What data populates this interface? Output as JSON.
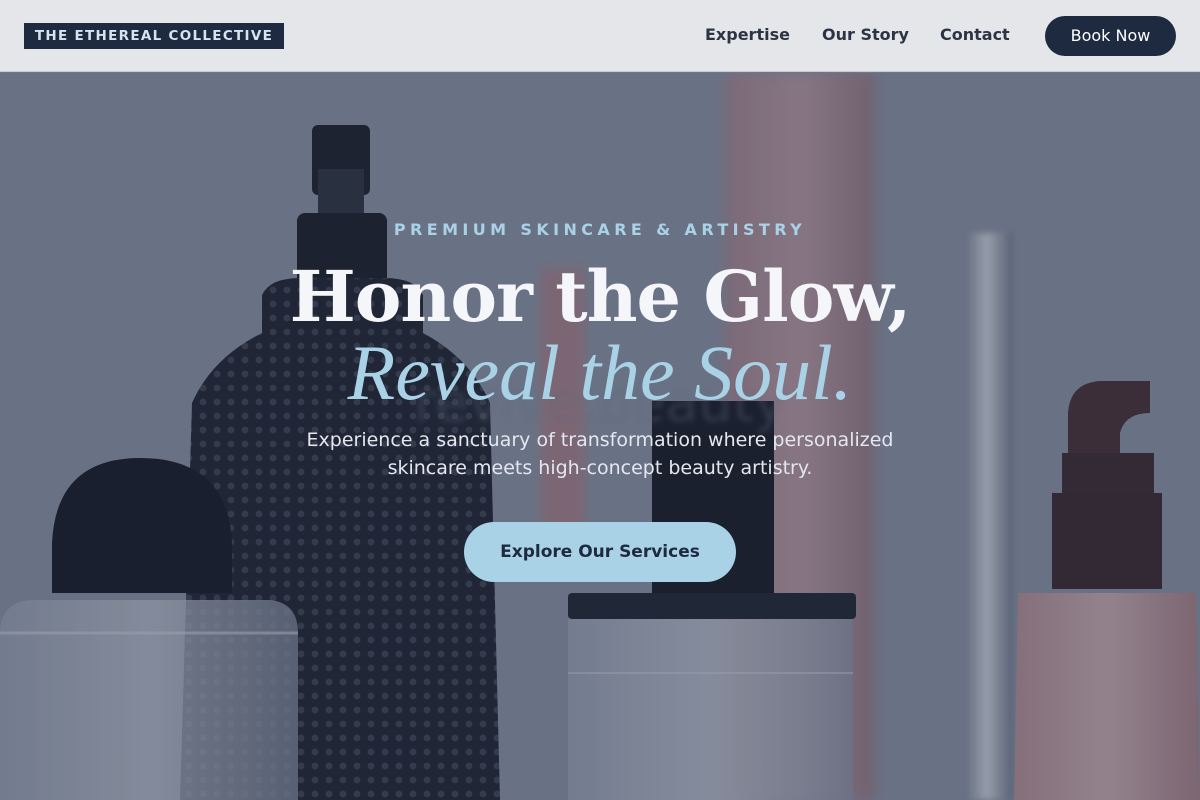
{
  "header": {
    "logo_text": "THE ETHEREAL COLLECTIVE",
    "nav": {
      "expertise": "Expertise",
      "our_story": "Our Story",
      "contact": "Contact"
    },
    "book_label": "Book Now"
  },
  "hero": {
    "eyebrow": "PREMIUM SKINCARE & ARTISTRY",
    "headline_line1": "Honor the Glow,",
    "headline_line2": "Reveal the Soul.",
    "lead": "Experience a sanctuary of transformation where personalized skincare meets high-concept beauty artistry.",
    "cta_label": "Explore Our Services"
  },
  "colors": {
    "navy": "#1d2a40",
    "accent_blue": "#a9d2e6",
    "header_bg": "#e4e6e9"
  }
}
